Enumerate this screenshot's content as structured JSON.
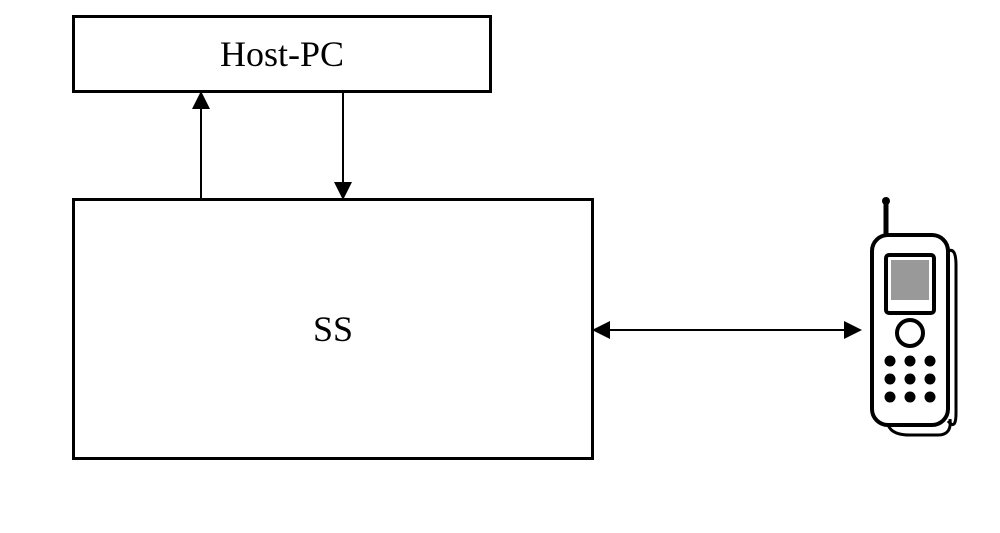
{
  "diagram": {
    "host_pc_label": "Host-PC",
    "ss_label": "SS",
    "components": {
      "host_pc": "Host-PC",
      "system_simulator": "SS",
      "device": "mobile-phone"
    },
    "connections": [
      {
        "from": "SS",
        "to": "Host-PC",
        "direction": "up"
      },
      {
        "from": "Host-PC",
        "to": "SS",
        "direction": "down"
      },
      {
        "from": "SS",
        "to": "mobile-phone",
        "direction": "bidirectional"
      }
    ]
  }
}
